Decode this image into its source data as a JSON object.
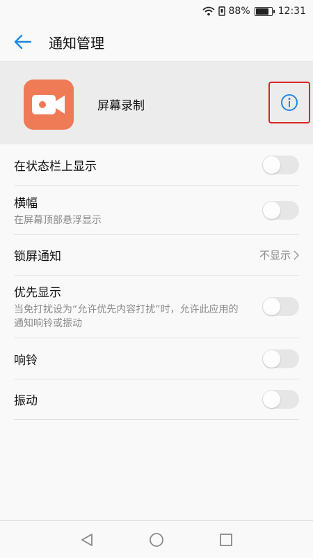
{
  "status_bar": {
    "battery_percent_label": "88%",
    "battery_level": 0.88,
    "time": "12:31"
  },
  "header": {
    "title": "通知管理"
  },
  "app": {
    "name": "屏幕录制",
    "icon_color": "#ef7a56",
    "icon": "video-camera-icon"
  },
  "settings": [
    {
      "title": "在状态栏上显示",
      "subtitle": "",
      "control": "toggle",
      "on": false
    },
    {
      "title": "横幅",
      "subtitle": "在屏幕顶部悬浮显示",
      "control": "toggle",
      "on": false
    },
    {
      "title": "锁屏通知",
      "subtitle": "",
      "control": "link",
      "value": "不显示"
    },
    {
      "title": "优先显示",
      "subtitle": "当免打扰设为“允许优先内容打扰”时，允许此应用的通知响铃或振动",
      "control": "toggle",
      "on": false
    },
    {
      "title": "响铃",
      "subtitle": "",
      "control": "toggle",
      "on": false
    },
    {
      "title": "振动",
      "subtitle": "",
      "control": "toggle",
      "on": false
    }
  ],
  "colors": {
    "accent": "#1e88e5",
    "highlight_border": "#d9262b"
  }
}
